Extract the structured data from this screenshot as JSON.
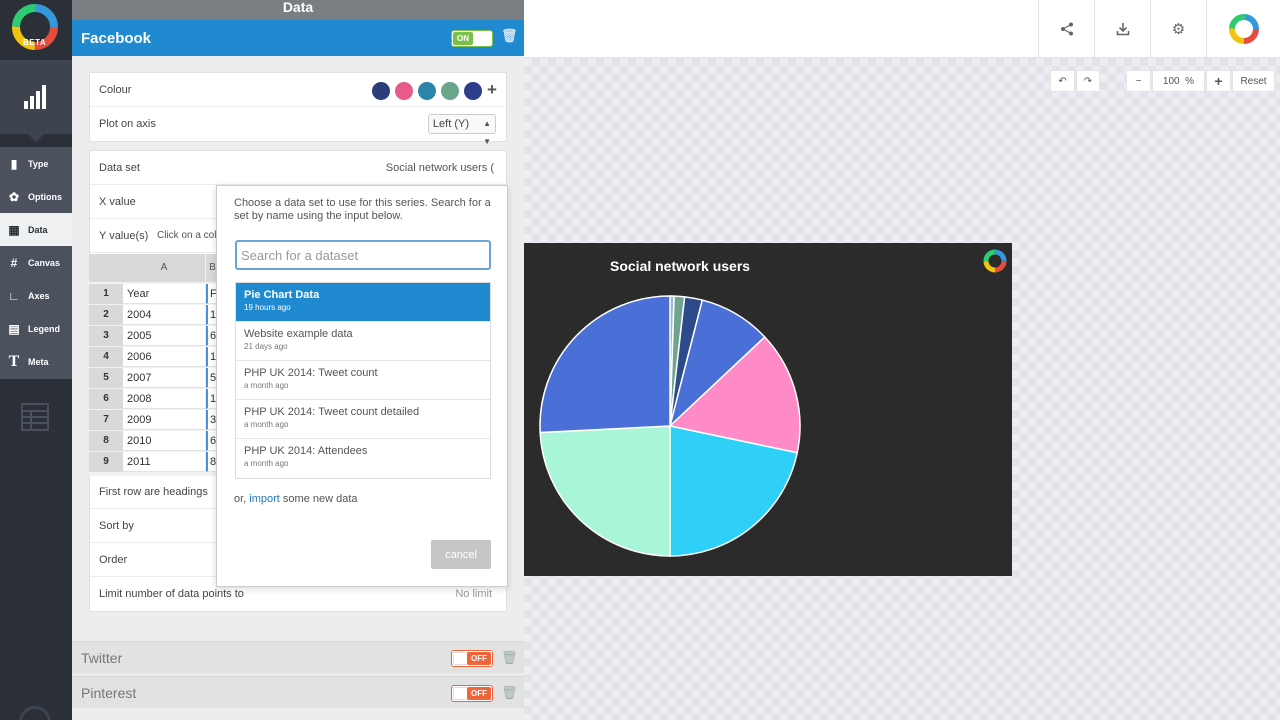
{
  "rail": {
    "beta": "BETA",
    "items": [
      {
        "label": "Type",
        "icon": "bar-chart-icon",
        "glyph": "▮"
      },
      {
        "label": "Options",
        "icon": "options-icon",
        "glyph": "✿"
      },
      {
        "label": "Data",
        "icon": "table-icon",
        "glyph": "▦"
      },
      {
        "label": "Canvas",
        "icon": "canvas-icon",
        "glyph": "#"
      },
      {
        "label": "Axes",
        "icon": "axes-icon",
        "glyph": "∟"
      },
      {
        "label": "Legend",
        "icon": "legend-icon",
        "glyph": "▤"
      },
      {
        "label": "Meta",
        "icon": "meta-icon",
        "glyph": "T"
      }
    ]
  },
  "panel": {
    "title": "Data",
    "series": {
      "name": "Facebook",
      "toggle": "ON",
      "colour_label": "Colour",
      "colours": [
        "#2c3e7a",
        "#e85a8a",
        "#2a86a8",
        "#6aa58c",
        "#2f3e8a"
      ],
      "add_colour": "+",
      "plot_axis_label": "Plot on axis",
      "plot_axis_value": "Left (Y)",
      "dataset_label": "Data set",
      "dataset_value": "Social network users (",
      "x_label": "X value",
      "y_label": "Y value(s)",
      "y_hint": "Click on a col",
      "first_row_label": "First row are headings",
      "sort_label": "Sort by",
      "order_label": "Order",
      "limit_label": "Limit number of data points to",
      "limit_value": "No limit"
    },
    "sheet": {
      "col_a": "A",
      "col_b": "B",
      "rows": [
        {
          "n": "1",
          "a": "Year",
          "b": "F"
        },
        {
          "n": "2",
          "a": "2004",
          "b": "1"
        },
        {
          "n": "3",
          "a": "2005",
          "b": "6"
        },
        {
          "n": "4",
          "a": "2006",
          "b": "1"
        },
        {
          "n": "5",
          "a": "2007",
          "b": "5"
        },
        {
          "n": "6",
          "a": "2008",
          "b": "1"
        },
        {
          "n": "7",
          "a": "2009",
          "b": "3"
        },
        {
          "n": "8",
          "a": "2010",
          "b": "6"
        },
        {
          "n": "9",
          "a": "2011",
          "b": "8"
        }
      ]
    },
    "other_series": [
      {
        "name": "Twitter",
        "toggle": "OFF"
      },
      {
        "name": "Pinterest",
        "toggle": "OFF"
      }
    ]
  },
  "dropdown": {
    "intro": "Choose a data set to use for this series. Search for a set by name using the input below.",
    "search_placeholder": "Search for a dataset",
    "datasets": [
      {
        "name": "Pie Chart Data",
        "time": "19 hours ago",
        "selected": true
      },
      {
        "name": "Website example data",
        "time": "21 days ago",
        "selected": false
      },
      {
        "name": "PHP UK 2014: Tweet count",
        "time": "a month ago",
        "selected": false
      },
      {
        "name": "PHP UK 2014: Tweet count detailed",
        "time": "a month ago",
        "selected": false
      },
      {
        "name": "PHP UK 2014: Attendees",
        "time": "a month ago",
        "selected": false
      }
    ],
    "import_prefix": "or,",
    "import_link": "import",
    "import_suffix": "some new data",
    "cancel": "cancel"
  },
  "toolbar": {
    "undo": "↶",
    "redo": "↷",
    "zoom_out": "−",
    "zoom_value": "100",
    "zoom_unit": "%",
    "zoom_in": "+",
    "reset": "Reset"
  },
  "chart_data": {
    "type": "pie",
    "title": "Social network users",
    "background": "#2b2b2b",
    "categories": [
      "",
      "",
      "",
      "",
      "",
      "",
      ""
    ],
    "values": [
      0.5,
      1.3,
      2.2,
      9.0,
      15.3,
      21.7,
      24.2,
      25.8
    ],
    "colors": [
      "#9fb6d6",
      "#6fa58e",
      "#2d4a8a",
      "#4a70d8",
      "#ff8ac8",
      "#2ed0f8",
      "#a8f5d8",
      "#4a70d8"
    ]
  }
}
